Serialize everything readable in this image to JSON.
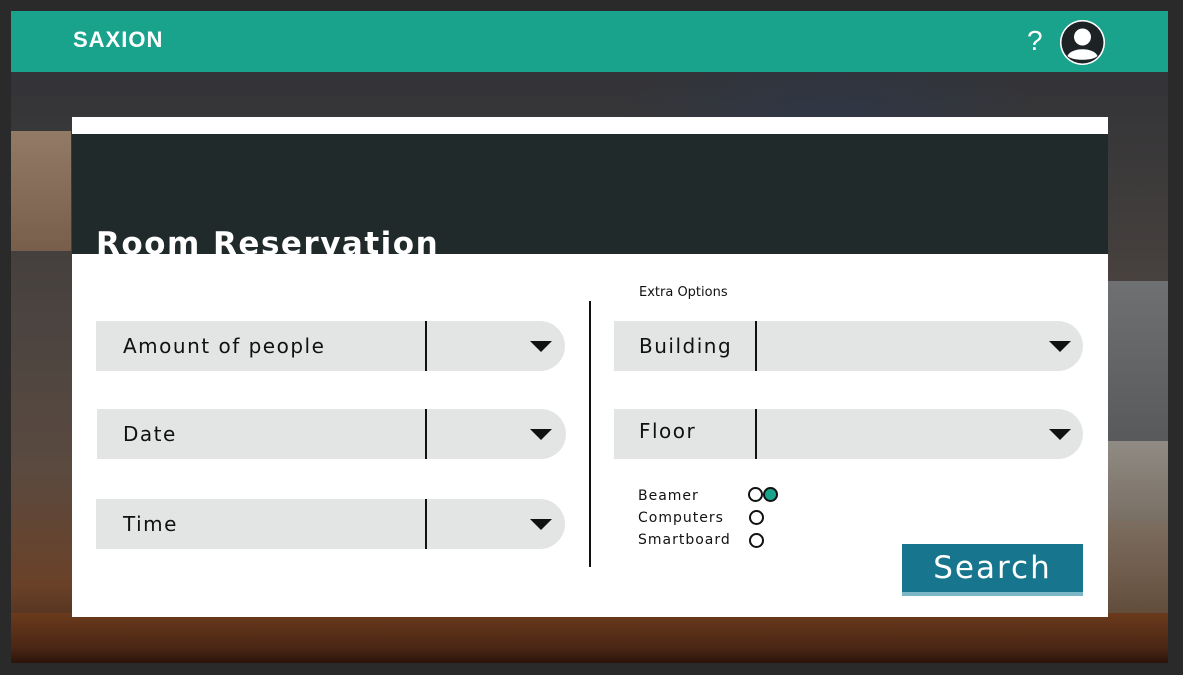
{
  "header": {
    "logo_text": "SAXION",
    "help_label": "?"
  },
  "card": {
    "title": "Room Reservation"
  },
  "left_fields": [
    {
      "label": "Amount of people",
      "value": ""
    },
    {
      "label": "Date",
      "value": ""
    },
    {
      "label": "Time",
      "value": ""
    }
  ],
  "extra": {
    "title": "Extra Options",
    "building_label": "Building",
    "floor_label": "Floor",
    "options": [
      {
        "label": "Beamer",
        "selected": true
      },
      {
        "label": "Computers",
        "selected": false
      },
      {
        "label": "Smartboard",
        "selected": false
      }
    ]
  },
  "search_label": "Search",
  "colors": {
    "brand_teal": "#1aa38c",
    "header_dark": "#212a2b",
    "search_blue": "#17768d",
    "field_grey": "#e3e5e5"
  }
}
